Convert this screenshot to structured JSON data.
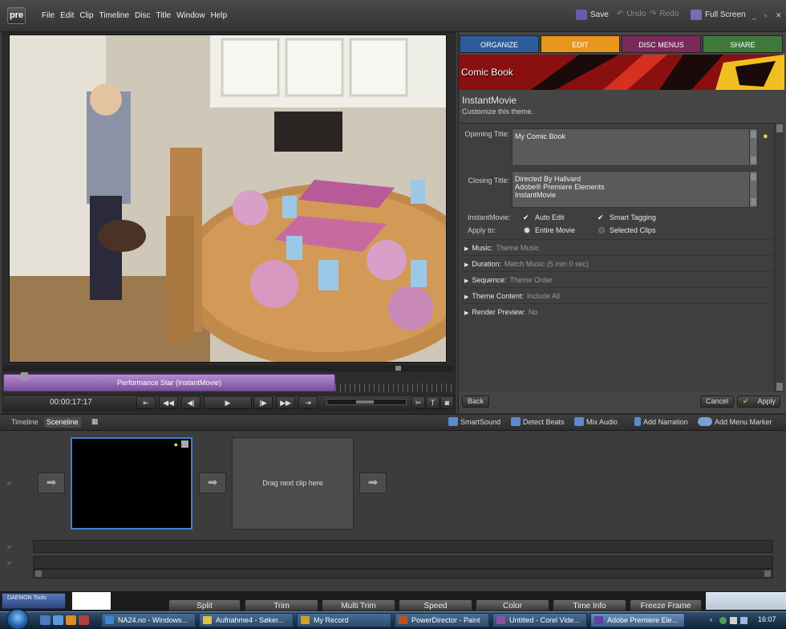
{
  "app": {
    "logo": "pre",
    "menu": [
      "File",
      "Edit",
      "Clip",
      "Timeline",
      "Disc",
      "Title",
      "Window",
      "Help"
    ],
    "save_label": "Save",
    "undo_label": "Undo",
    "redo_label": "Redo",
    "fullscreen_label": "Full Screen",
    "window_controls": [
      "_",
      "▫",
      "✕"
    ]
  },
  "preview": {
    "clip_name": "Performance Star (InstantMovie)",
    "timecode": "00:00:17:17"
  },
  "panel": {
    "tabs": [
      {
        "label": "ORGANIZE",
        "color": "#2d5c9a"
      },
      {
        "label": "EDIT",
        "color": "#e8961e"
      },
      {
        "label": "DISC MENUS",
        "color": "#7a2a5a"
      },
      {
        "label": "SHARE",
        "color": "#3f7a3a"
      }
    ],
    "theme_banner": "Comic Book",
    "theme_name": "InstantMovie",
    "theme_sub": "Customize this theme.",
    "opening_title_label": "Opening Title:",
    "opening_title_value": "My Comic Book",
    "closing_title_label": "Closing Title:",
    "closing_title_lines": [
      "Directed By Hallvard",
      "Adobe® Premiere Elements",
      "InstantMovie"
    ],
    "instantmovie_label": "InstantMovie:",
    "auto_edit": "Auto Edit",
    "smart_tagging": "Smart Tagging",
    "apply_to_label": "Apply to:",
    "entire_movie": "Entire Movie",
    "selected_clips": "Selected Clips",
    "sections": [
      {
        "label": "Music:",
        "value": "Theme Music"
      },
      {
        "label": "Duration:",
        "value": "Match Music (5 min 0 sec)"
      },
      {
        "label": "Sequence:",
        "value": "Theme Order"
      },
      {
        "label": "Theme Content:",
        "value": "Include All"
      },
      {
        "label": "Render Preview:",
        "value": "No"
      }
    ],
    "back": "Back",
    "cancel": "Cancel",
    "apply": "Apply"
  },
  "sceneline": {
    "tabs": [
      "Timeline",
      "Sceneline"
    ],
    "tools": [
      "SmartSound",
      "Detect Beats",
      "Mix Audio",
      "Add Narration",
      "Add Menu Marker"
    ],
    "drag_hint": "Drag next clip here"
  },
  "bottom": {
    "daemon_label": "DAEMON Tools",
    "edit_tabs": [
      "Split",
      "Trim",
      "Multi Trim",
      "Speed",
      "Color",
      "Time Info",
      "Freeze Frame"
    ]
  },
  "taskbar": {
    "items": [
      {
        "label": "NA24.no - Windows...",
        "color": "#3a86d0"
      },
      {
        "label": "Aufnahme4 - Søker...",
        "color": "#e0c040"
      },
      {
        "label": "My Record",
        "color": "#d0a020"
      },
      {
        "label": "PowerDirector - Paint",
        "color": "#c05020"
      },
      {
        "label": "Untitled - Corel Vide...",
        "color": "#9050a0"
      },
      {
        "label": "Adobe Premiere Ele...",
        "color": "#6040a0"
      }
    ],
    "clock": "16:07"
  }
}
